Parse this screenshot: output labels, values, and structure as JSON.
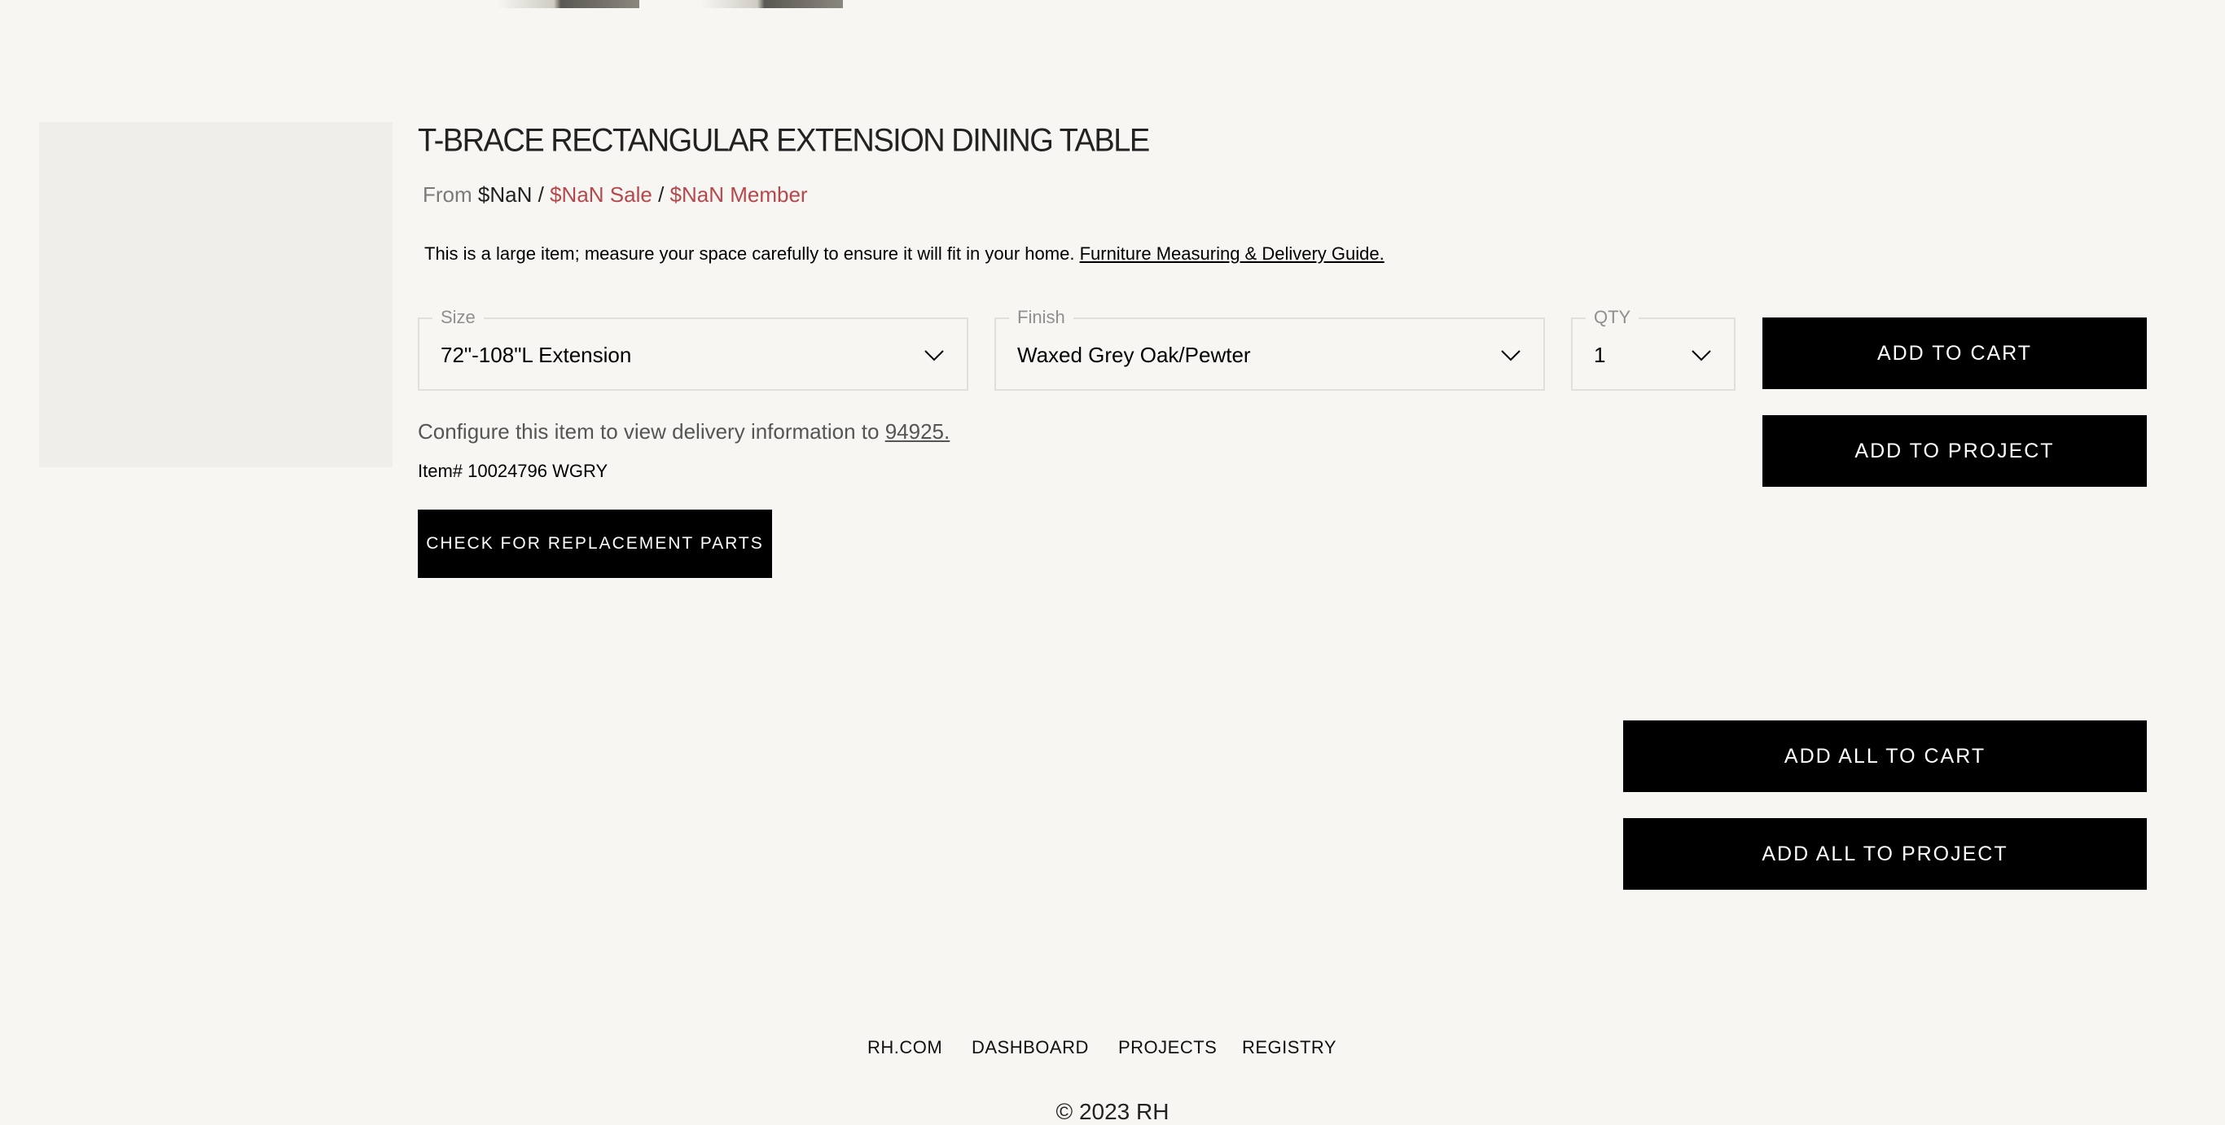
{
  "product": {
    "title": "T-BRACE RECTANGULAR EXTENSION DINING TABLE",
    "price_from_label": "From",
    "price_regular": "$NaN",
    "price_sep": "/",
    "price_sale": "$NaN Sale",
    "price_member": "$NaN Member",
    "notice_text": "This is a large item; measure your space carefully to ensure it will fit in your home.",
    "notice_link": "Furniture Measuring & Delivery Guide.",
    "item_number": "Item# 10024796 WGRY"
  },
  "options": {
    "size": {
      "label": "Size",
      "value": "72\"-108\"L Extension",
      "icon": "chevron-down-icon"
    },
    "finish": {
      "label": "Finish",
      "value": "Waxed Grey Oak/Pewter",
      "icon": "chevron-down-icon"
    },
    "qty": {
      "label": "QTY",
      "value": "1",
      "icon": "chevron-down-icon"
    }
  },
  "delivery": {
    "text": "Configure this item to view delivery information to",
    "zip": "94925."
  },
  "buttons": {
    "add_to_cart": "ADD TO CART",
    "add_to_project": "ADD TO PROJECT",
    "replacement_parts": "CHECK FOR REPLACEMENT PARTS",
    "add_all_to_cart": "ADD ALL TO CART",
    "add_all_to_project": "ADD ALL TO PROJECT"
  },
  "footer": {
    "links": [
      "RH.COM",
      "DASHBOARD",
      "PROJECTS",
      "REGISTRY"
    ],
    "copyright": "© 2023 RH"
  },
  "colors": {
    "background": "#f7f6f2",
    "sale_red": "#b5484c",
    "button_black": "#000000"
  }
}
